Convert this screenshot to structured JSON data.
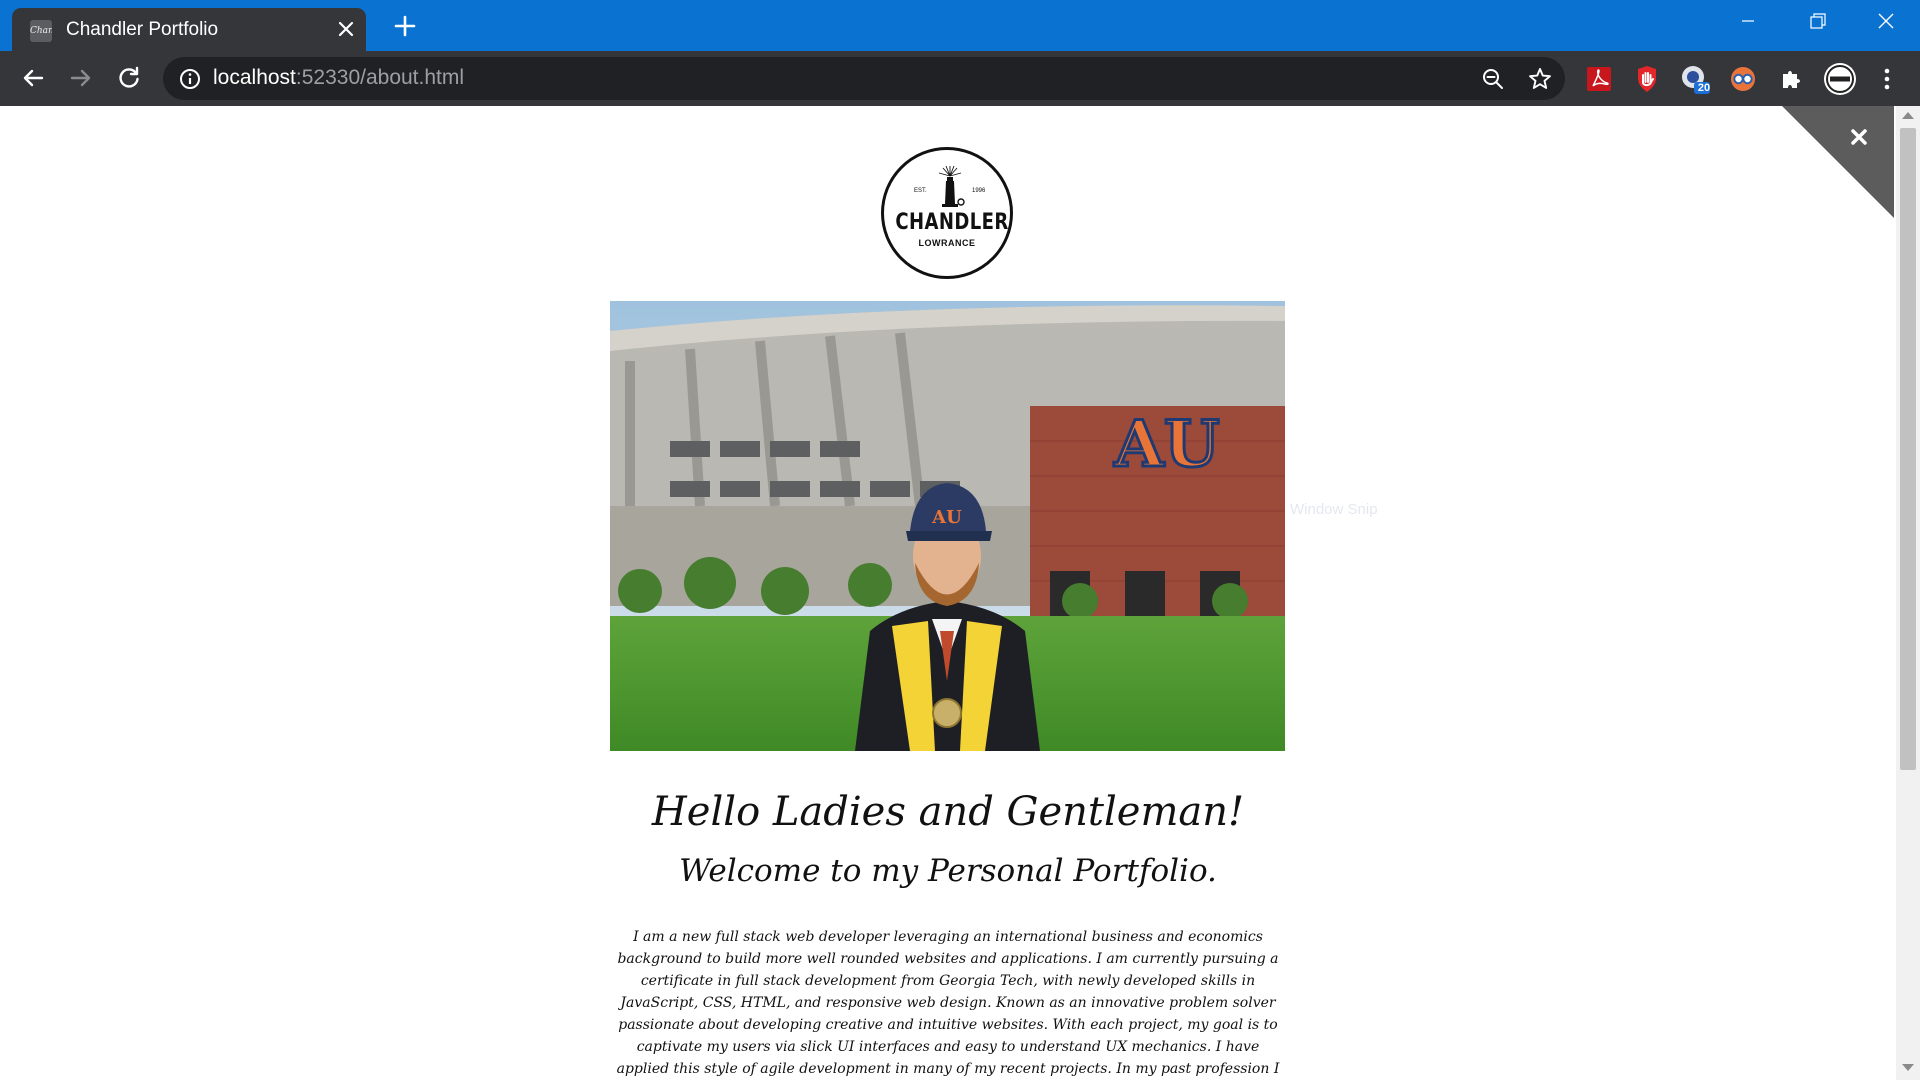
{
  "browser": {
    "tab_title": "Chandler Portfolio",
    "favicon_text": "Chan",
    "url_host": "localhost",
    "url_rest": ":52330/about.html",
    "extension_badge": "20"
  },
  "page": {
    "logo": {
      "est": "EST.",
      "year": "1996",
      "name": "CHANDLER",
      "sub": "LOWRANCE"
    },
    "hero_alt": "Graduate in cap and gown in front of Auburn stadium",
    "overlay_hint": "Window Snip",
    "heading": "Hello Ladies and Gentleman!",
    "subheading": "Welcome to my Personal Portfolio.",
    "bio": "I am a new full stack web developer leveraging an international business and economics background to build more well rounded websites and applications. I am currently pursuing a certificate in full stack development from Georgia Tech, with newly developed skills in JavaScript, CSS, HTML, and responsive web design. Known as an innovative problem solver passionate about developing creative and intuitive websites. With each project, my goal is to captivate my users via slick UI interfaces and easy to understand UX mechanics. I have applied this style of agile development in many of my recent projects. In my past profession I managed millions of dollars"
  },
  "icons": [
    "close-icon",
    "plus-icon",
    "minimize-icon",
    "restore-icon",
    "back-arrow-icon",
    "forward-arrow-icon",
    "reload-icon",
    "info-icon",
    "zoom-out-icon",
    "star-icon",
    "pdf-icon",
    "adblock-icon",
    "extension-badge-icon",
    "glasses-icon",
    "puzzle-icon",
    "avatar-icon",
    "more-icon"
  ]
}
